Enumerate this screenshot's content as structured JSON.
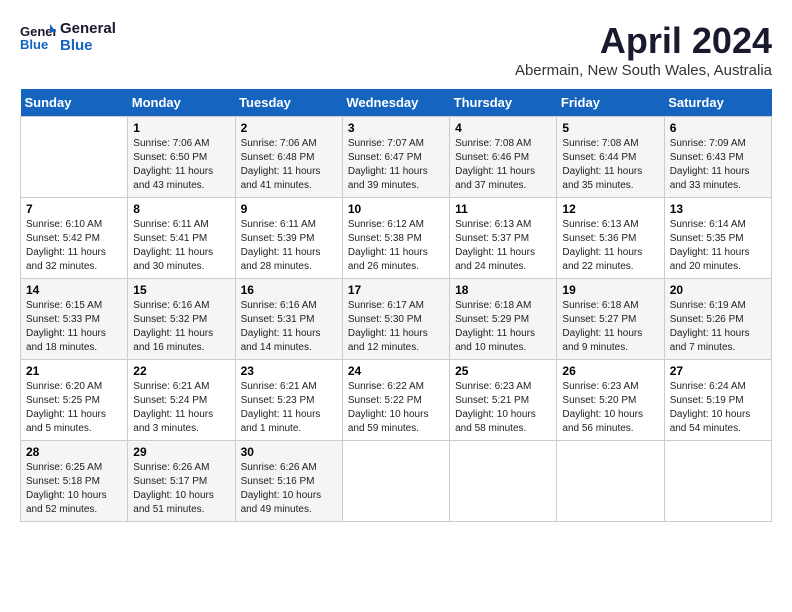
{
  "header": {
    "logo_line1": "General",
    "logo_line2": "Blue",
    "title": "April 2024",
    "subtitle": "Abermain, New South Wales, Australia"
  },
  "weekdays": [
    "Sunday",
    "Monday",
    "Tuesday",
    "Wednesday",
    "Thursday",
    "Friday",
    "Saturday"
  ],
  "weeks": [
    [
      {
        "day": "",
        "sunrise": "",
        "sunset": "",
        "daylight": ""
      },
      {
        "day": "1",
        "sunrise": "Sunrise: 7:06 AM",
        "sunset": "Sunset: 6:50 PM",
        "daylight": "Daylight: 11 hours and 43 minutes."
      },
      {
        "day": "2",
        "sunrise": "Sunrise: 7:06 AM",
        "sunset": "Sunset: 6:48 PM",
        "daylight": "Daylight: 11 hours and 41 minutes."
      },
      {
        "day": "3",
        "sunrise": "Sunrise: 7:07 AM",
        "sunset": "Sunset: 6:47 PM",
        "daylight": "Daylight: 11 hours and 39 minutes."
      },
      {
        "day": "4",
        "sunrise": "Sunrise: 7:08 AM",
        "sunset": "Sunset: 6:46 PM",
        "daylight": "Daylight: 11 hours and 37 minutes."
      },
      {
        "day": "5",
        "sunrise": "Sunrise: 7:08 AM",
        "sunset": "Sunset: 6:44 PM",
        "daylight": "Daylight: 11 hours and 35 minutes."
      },
      {
        "day": "6",
        "sunrise": "Sunrise: 7:09 AM",
        "sunset": "Sunset: 6:43 PM",
        "daylight": "Daylight: 11 hours and 33 minutes."
      }
    ],
    [
      {
        "day": "7",
        "sunrise": "Sunrise: 6:10 AM",
        "sunset": "Sunset: 5:42 PM",
        "daylight": "Daylight: 11 hours and 32 minutes."
      },
      {
        "day": "8",
        "sunrise": "Sunrise: 6:11 AM",
        "sunset": "Sunset: 5:41 PM",
        "daylight": "Daylight: 11 hours and 30 minutes."
      },
      {
        "day": "9",
        "sunrise": "Sunrise: 6:11 AM",
        "sunset": "Sunset: 5:39 PM",
        "daylight": "Daylight: 11 hours and 28 minutes."
      },
      {
        "day": "10",
        "sunrise": "Sunrise: 6:12 AM",
        "sunset": "Sunset: 5:38 PM",
        "daylight": "Daylight: 11 hours and 26 minutes."
      },
      {
        "day": "11",
        "sunrise": "Sunrise: 6:13 AM",
        "sunset": "Sunset: 5:37 PM",
        "daylight": "Daylight: 11 hours and 24 minutes."
      },
      {
        "day": "12",
        "sunrise": "Sunrise: 6:13 AM",
        "sunset": "Sunset: 5:36 PM",
        "daylight": "Daylight: 11 hours and 22 minutes."
      },
      {
        "day": "13",
        "sunrise": "Sunrise: 6:14 AM",
        "sunset": "Sunset: 5:35 PM",
        "daylight": "Daylight: 11 hours and 20 minutes."
      }
    ],
    [
      {
        "day": "14",
        "sunrise": "Sunrise: 6:15 AM",
        "sunset": "Sunset: 5:33 PM",
        "daylight": "Daylight: 11 hours and 18 minutes."
      },
      {
        "day": "15",
        "sunrise": "Sunrise: 6:16 AM",
        "sunset": "Sunset: 5:32 PM",
        "daylight": "Daylight: 11 hours and 16 minutes."
      },
      {
        "day": "16",
        "sunrise": "Sunrise: 6:16 AM",
        "sunset": "Sunset: 5:31 PM",
        "daylight": "Daylight: 11 hours and 14 minutes."
      },
      {
        "day": "17",
        "sunrise": "Sunrise: 6:17 AM",
        "sunset": "Sunset: 5:30 PM",
        "daylight": "Daylight: 11 hours and 12 minutes."
      },
      {
        "day": "18",
        "sunrise": "Sunrise: 6:18 AM",
        "sunset": "Sunset: 5:29 PM",
        "daylight": "Daylight: 11 hours and 10 minutes."
      },
      {
        "day": "19",
        "sunrise": "Sunrise: 6:18 AM",
        "sunset": "Sunset: 5:27 PM",
        "daylight": "Daylight: 11 hours and 9 minutes."
      },
      {
        "day": "20",
        "sunrise": "Sunrise: 6:19 AM",
        "sunset": "Sunset: 5:26 PM",
        "daylight": "Daylight: 11 hours and 7 minutes."
      }
    ],
    [
      {
        "day": "21",
        "sunrise": "Sunrise: 6:20 AM",
        "sunset": "Sunset: 5:25 PM",
        "daylight": "Daylight: 11 hours and 5 minutes."
      },
      {
        "day": "22",
        "sunrise": "Sunrise: 6:21 AM",
        "sunset": "Sunset: 5:24 PM",
        "daylight": "Daylight: 11 hours and 3 minutes."
      },
      {
        "day": "23",
        "sunrise": "Sunrise: 6:21 AM",
        "sunset": "Sunset: 5:23 PM",
        "daylight": "Daylight: 11 hours and 1 minute."
      },
      {
        "day": "24",
        "sunrise": "Sunrise: 6:22 AM",
        "sunset": "Sunset: 5:22 PM",
        "daylight": "Daylight: 10 hours and 59 minutes."
      },
      {
        "day": "25",
        "sunrise": "Sunrise: 6:23 AM",
        "sunset": "Sunset: 5:21 PM",
        "daylight": "Daylight: 10 hours and 58 minutes."
      },
      {
        "day": "26",
        "sunrise": "Sunrise: 6:23 AM",
        "sunset": "Sunset: 5:20 PM",
        "daylight": "Daylight: 10 hours and 56 minutes."
      },
      {
        "day": "27",
        "sunrise": "Sunrise: 6:24 AM",
        "sunset": "Sunset: 5:19 PM",
        "daylight": "Daylight: 10 hours and 54 minutes."
      }
    ],
    [
      {
        "day": "28",
        "sunrise": "Sunrise: 6:25 AM",
        "sunset": "Sunset: 5:18 PM",
        "daylight": "Daylight: 10 hours and 52 minutes."
      },
      {
        "day": "29",
        "sunrise": "Sunrise: 6:26 AM",
        "sunset": "Sunset: 5:17 PM",
        "daylight": "Daylight: 10 hours and 51 minutes."
      },
      {
        "day": "30",
        "sunrise": "Sunrise: 6:26 AM",
        "sunset": "Sunset: 5:16 PM",
        "daylight": "Daylight: 10 hours and 49 minutes."
      },
      {
        "day": "",
        "sunrise": "",
        "sunset": "",
        "daylight": ""
      },
      {
        "day": "",
        "sunrise": "",
        "sunset": "",
        "daylight": ""
      },
      {
        "day": "",
        "sunrise": "",
        "sunset": "",
        "daylight": ""
      },
      {
        "day": "",
        "sunrise": "",
        "sunset": "",
        "daylight": ""
      }
    ]
  ]
}
